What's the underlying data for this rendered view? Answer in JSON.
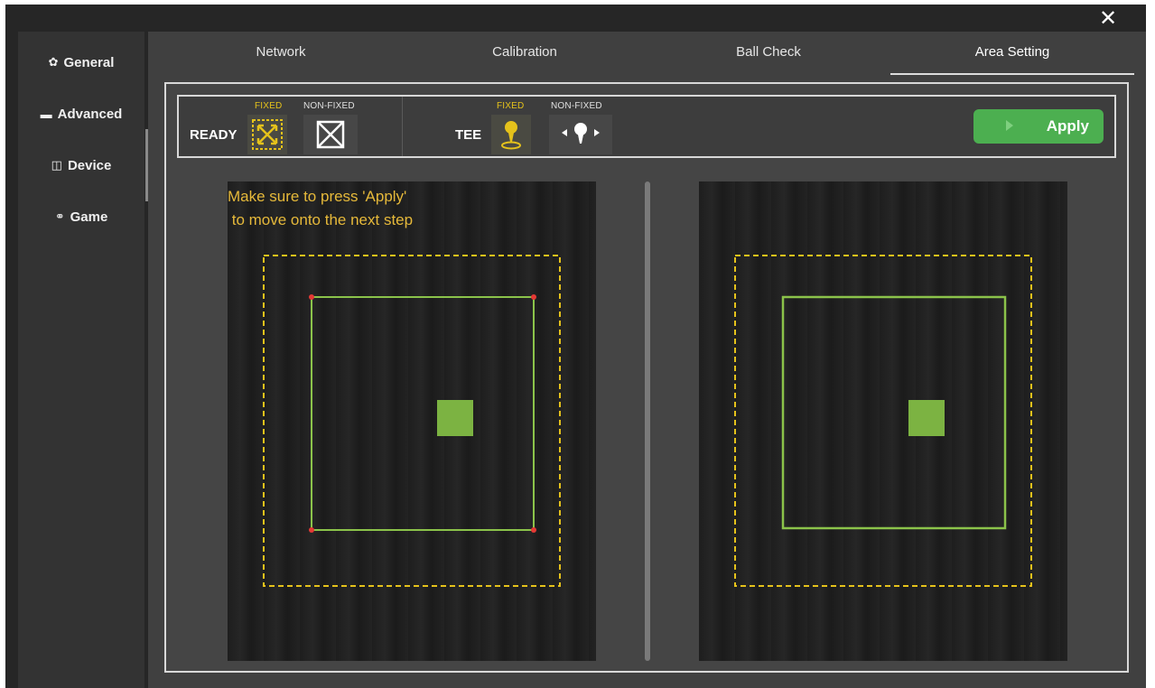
{
  "window": {
    "close_glyph": "✕"
  },
  "sidebar": {
    "items": [
      {
        "label": "General",
        "icon": "gear-icon",
        "glyph": "✿"
      },
      {
        "label": "Advanced",
        "icon": "chat-bubble-icon",
        "glyph": "▬"
      },
      {
        "label": "Device",
        "icon": "device-icon",
        "glyph": "◫"
      },
      {
        "label": "Game",
        "icon": "gamepad-icon",
        "glyph": "⚭"
      }
    ],
    "active": "Device"
  },
  "tabs": [
    {
      "label": "Network"
    },
    {
      "label": "Calibration"
    },
    {
      "label": "Ball Check"
    },
    {
      "label": "Area Setting"
    }
  ],
  "active_tab": "Area Setting",
  "toolbar": {
    "ready_label": "READY",
    "tee_label": "TEE",
    "fixed_label": "FIXED",
    "non_fixed_label": "NON-FIXED",
    "ready_mode": "FIXED",
    "tee_mode": "FIXED",
    "apply_label": "Apply"
  },
  "hint": {
    "line1": "Make sure to press 'Apply'",
    "line2": " to move onto the next step"
  },
  "colors": {
    "accent_yellow": "#e5c21b",
    "apply_green": "#4caf50",
    "area_green": "#8bc34a",
    "target_green": "#7cb342",
    "corner_red": "#e53935"
  }
}
